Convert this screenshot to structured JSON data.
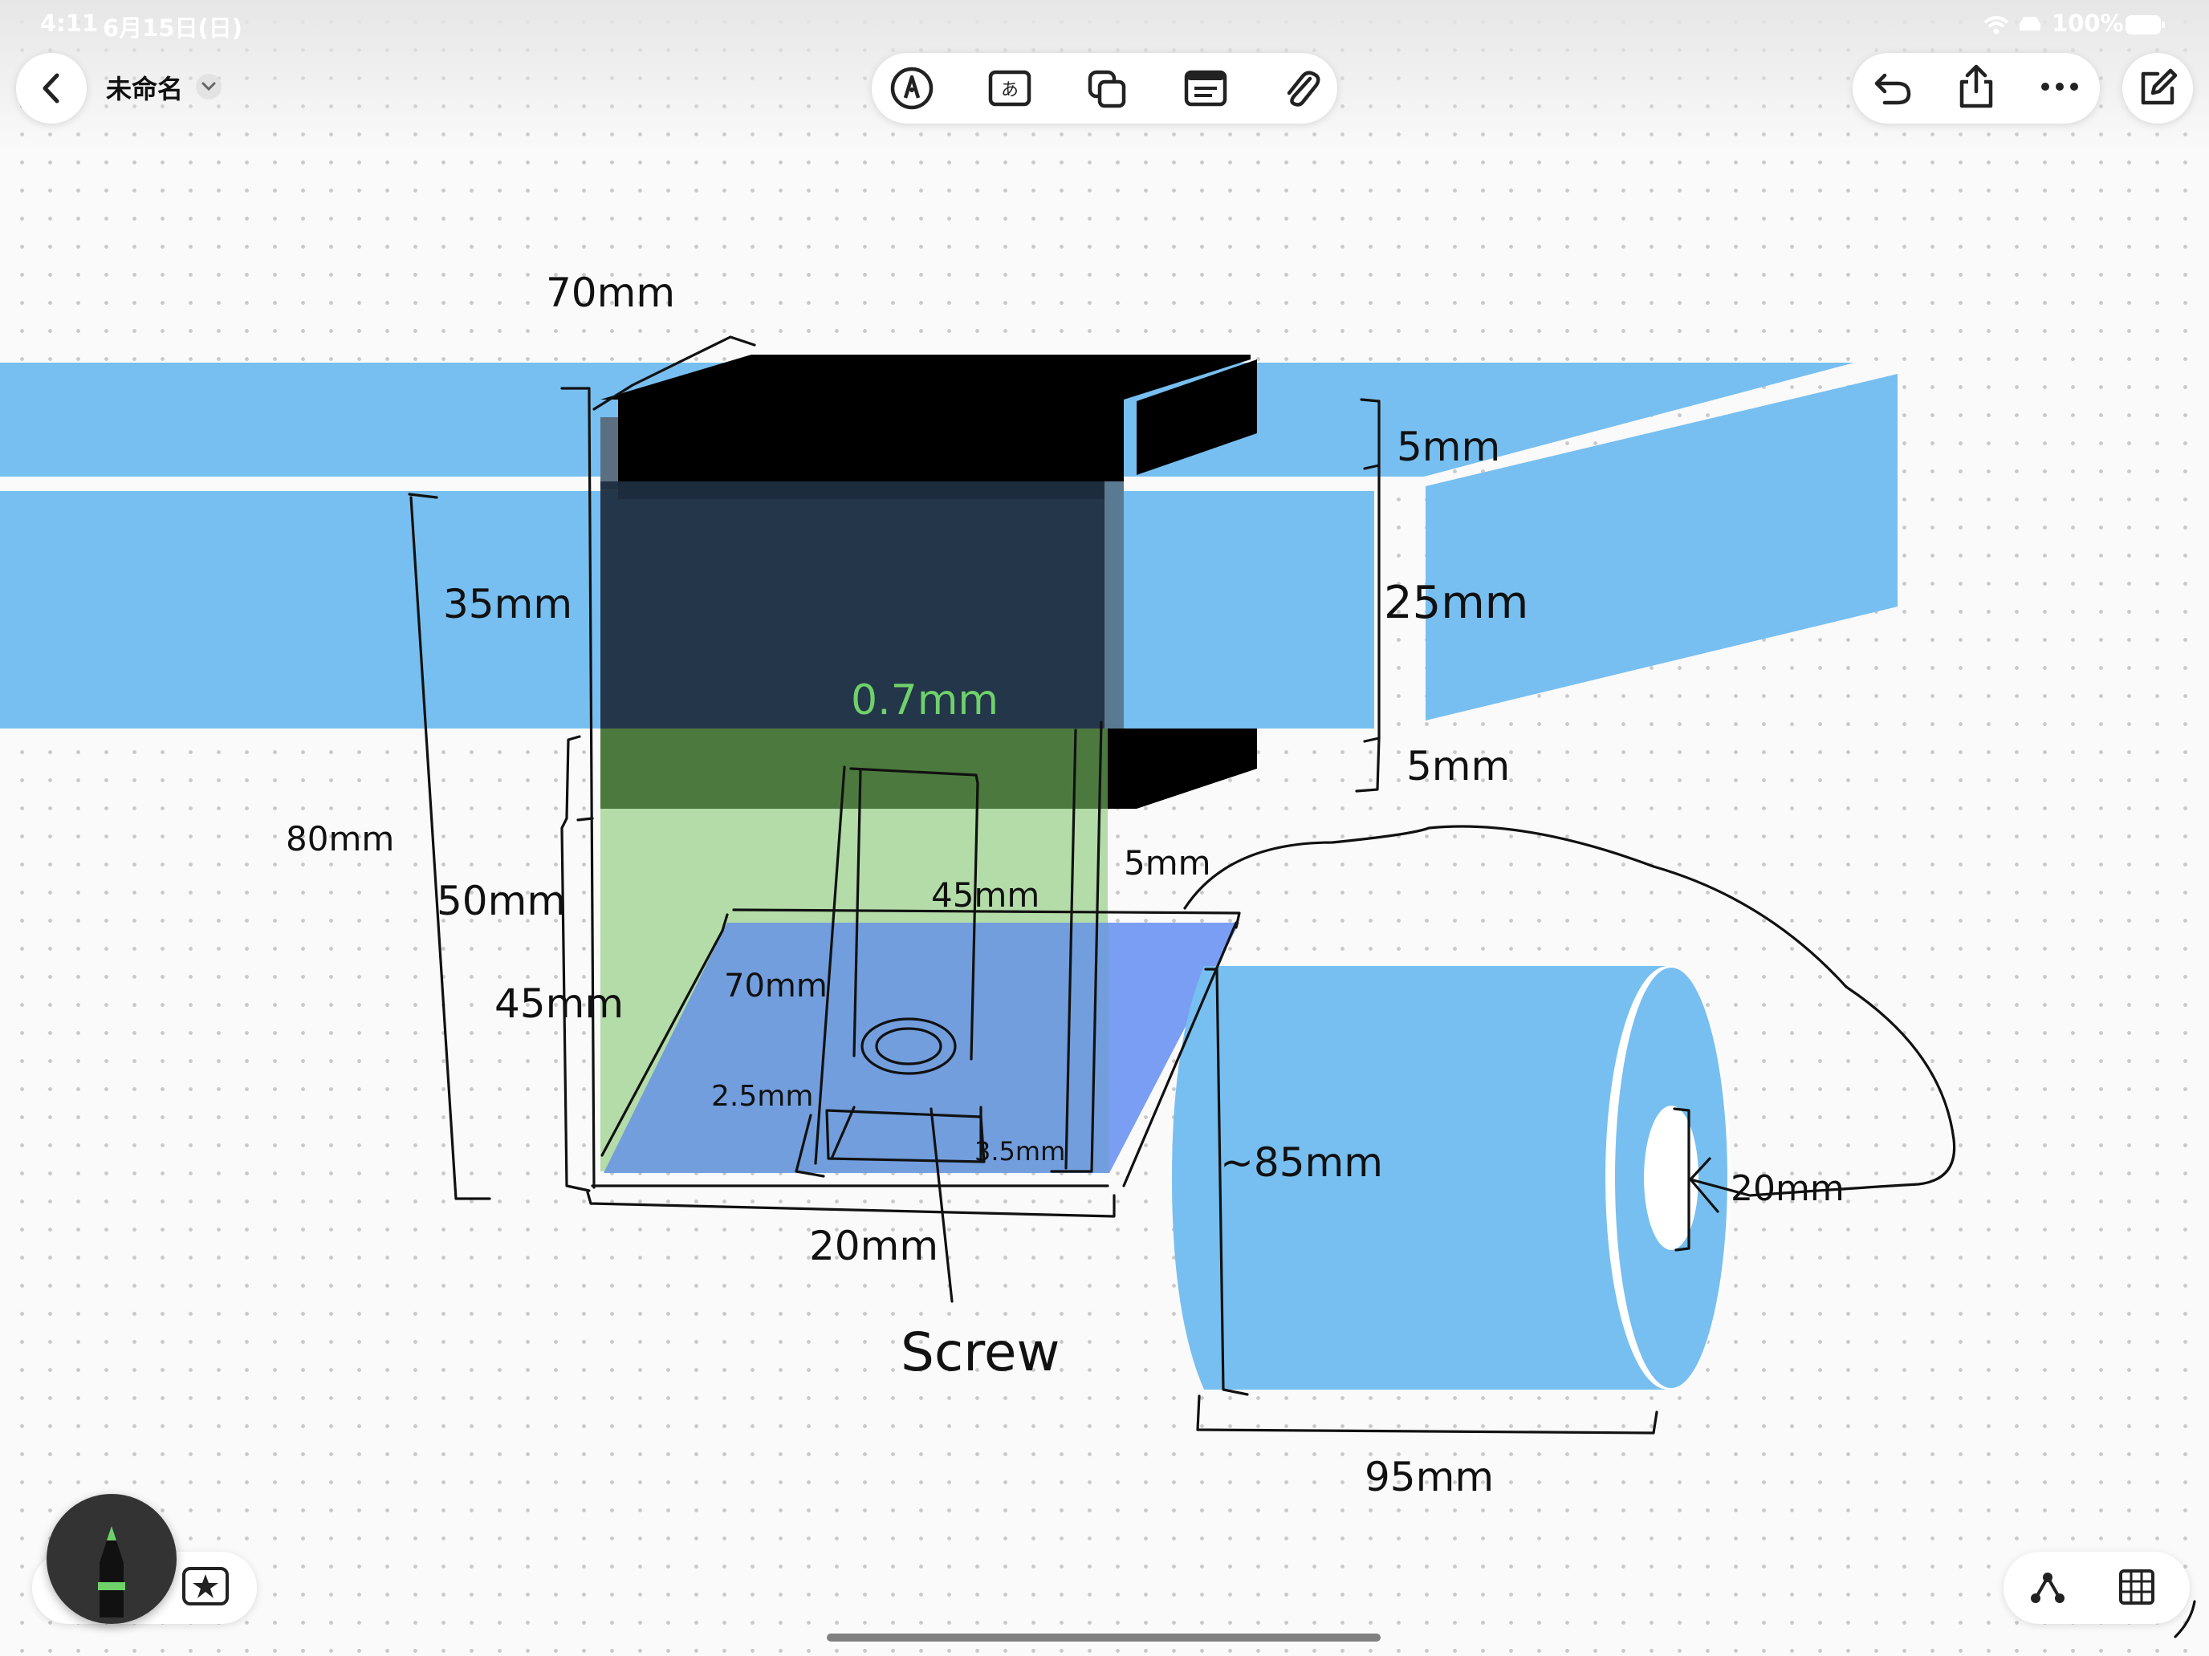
{
  "status_bar": {
    "time": "4:11",
    "date": "6月15日(日)",
    "battery": "100%"
  },
  "toolbar": {
    "title": "未命名",
    "center_tools": [
      "pen-tool-icon",
      "text-box-icon",
      "shapes-icon",
      "card-icon",
      "attachment-icon"
    ],
    "right_tools": [
      "undo-icon",
      "share-icon",
      "more-icon"
    ],
    "compose": "compose-icon"
  },
  "drawing": {
    "labels": {
      "top_width": "70mm",
      "right_5a": "5mm",
      "right_25": "25mm",
      "right_5b": "5mm",
      "left_35": "35mm",
      "left_80": "80mm",
      "left_50": "50mm",
      "left_45": "45mm",
      "green_thickness": "0.7mm",
      "side_5": "5mm",
      "inner_45": "45mm",
      "inner_70": "70mm",
      "inner_2_5": "2.5mm",
      "inner_3_5": "3.5mm",
      "bottom_20": "20mm",
      "screw": "Screw",
      "roll_85": "~85mm",
      "roll_20": "20mm",
      "roll_95": "95mm"
    },
    "colors": {
      "blue": "#77bff0",
      "black": "#000000",
      "green": "#b3dca8",
      "purple_blue": "#7a9ef3",
      "green_ink": "#6fd16a"
    }
  },
  "bottom": {
    "pen_button": "pencil-icon",
    "favorites": "star-icon",
    "right_tools": [
      "lasso-icon",
      "grid-icon"
    ]
  }
}
